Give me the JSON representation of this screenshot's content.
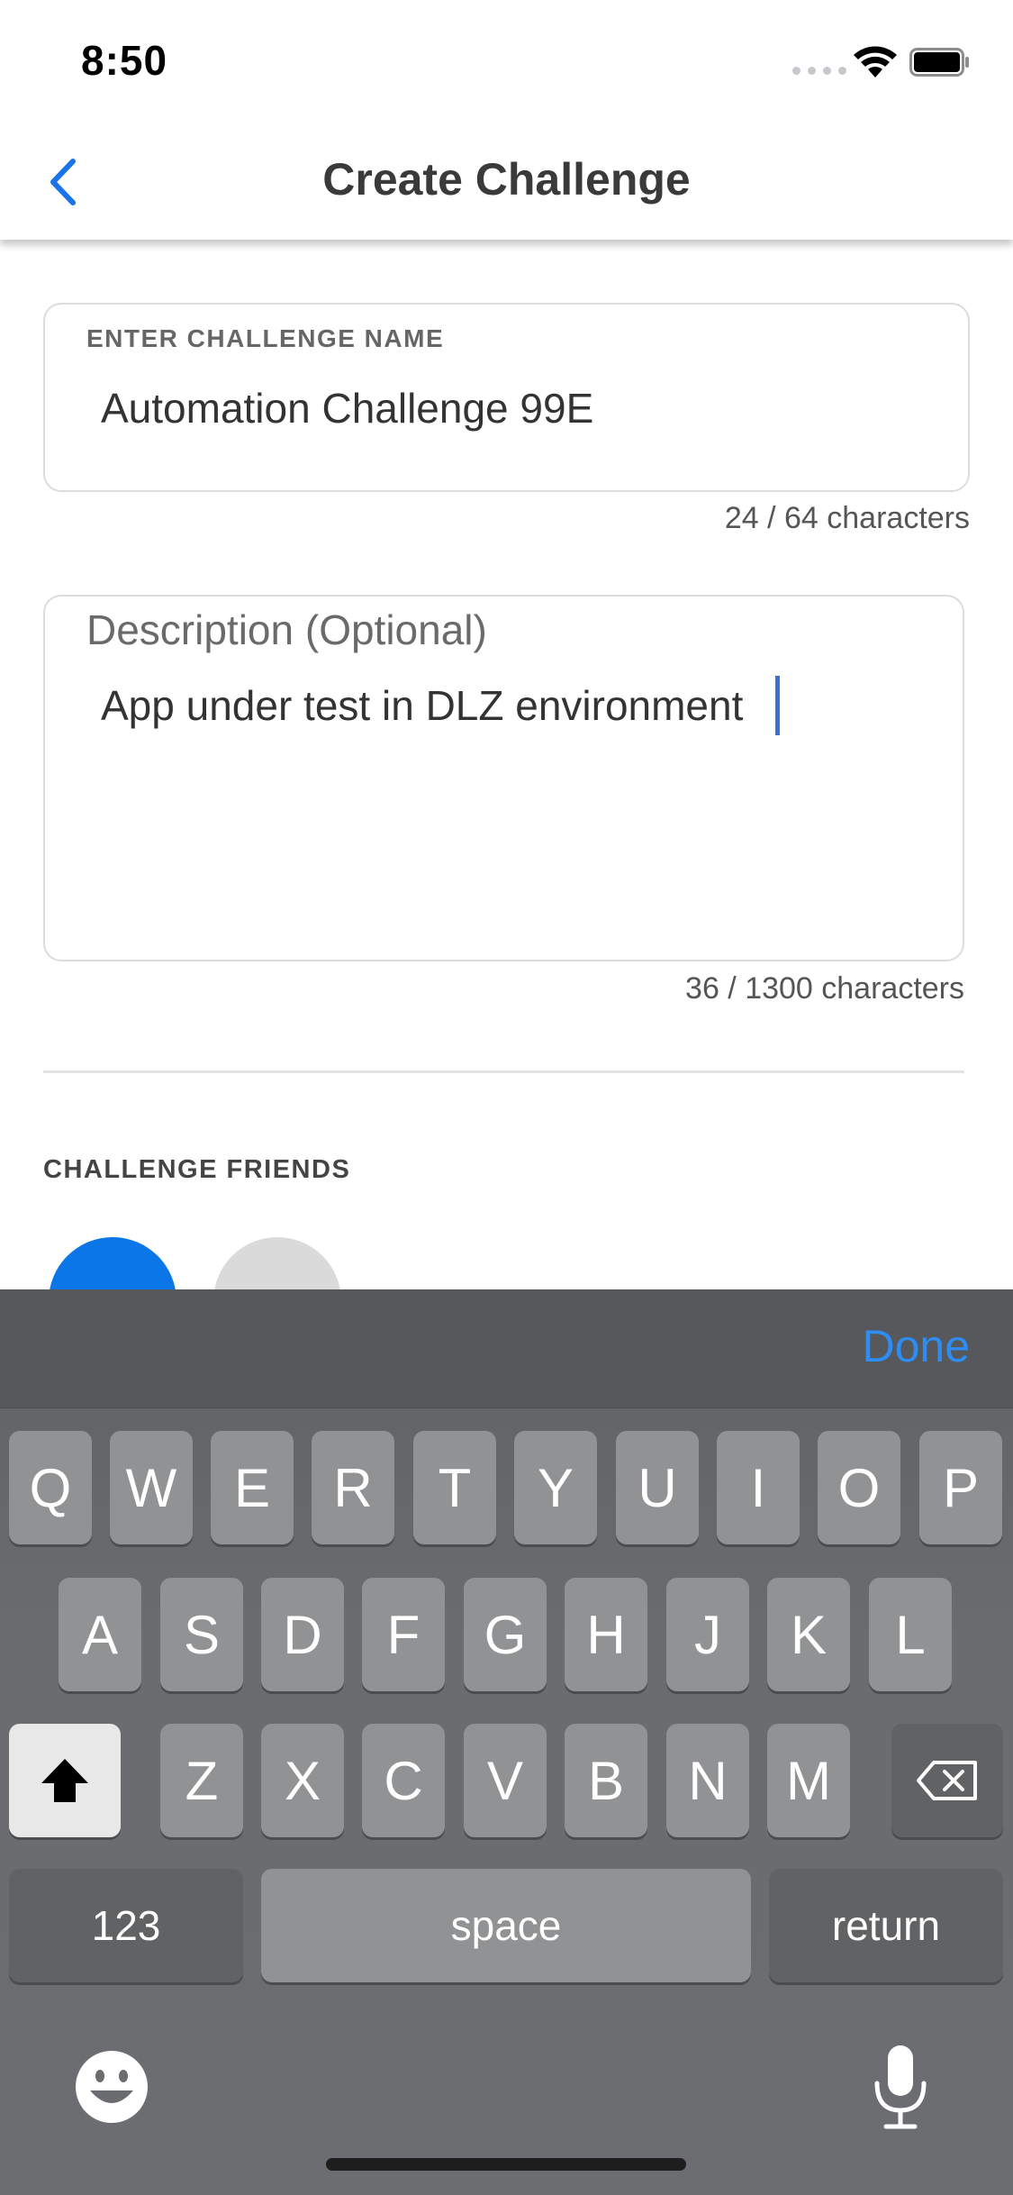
{
  "status_bar": {
    "time": "8:50"
  },
  "nav": {
    "title": "Create Challenge"
  },
  "form": {
    "name_label": "ENTER CHALLENGE NAME",
    "name_value": "Automation Challenge 99E",
    "name_counter": "24 / 64 characters",
    "description_label": "Description (Optional)",
    "description_value": "App under test in DLZ environment",
    "description_counter": "36 / 1300 characters"
  },
  "friends": {
    "heading": "CHALLENGE FRIENDS"
  },
  "keyboard": {
    "done_label": "Done",
    "row1": [
      "Q",
      "W",
      "E",
      "R",
      "T",
      "Y",
      "U",
      "I",
      "O",
      "P"
    ],
    "row2": [
      "A",
      "S",
      "D",
      "F",
      "G",
      "H",
      "J",
      "K",
      "L"
    ],
    "row3": [
      "Z",
      "X",
      "C",
      "V",
      "B",
      "N",
      "M"
    ],
    "numbers_label": "123",
    "space_label": "space",
    "return_label": "return"
  },
  "colors": {
    "accent": "#0a76e8",
    "done": "#2f8cf0",
    "caret": "#3b6fd6"
  },
  "icons": [
    "back-chevron-icon",
    "wifi-icon",
    "battery-icon",
    "shift-icon",
    "backspace-icon",
    "emoji-icon",
    "microphone-icon"
  ]
}
